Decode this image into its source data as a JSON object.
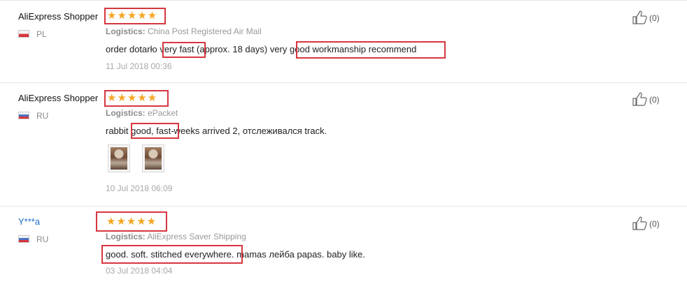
{
  "reviews": [
    {
      "user": "AliExpress Shopper",
      "country": "PL",
      "stars": "★★★★★",
      "logistics_label": "Logistics:",
      "logistics_value": "China Post Registered Air Mail",
      "text": "order dotarło very fast (approx. 18 days) very good workmanship recommend",
      "date": "11 Jul 2018 00:36",
      "helpful_count": "(0)"
    },
    {
      "user": "AliExpress Shopper",
      "country": "RU",
      "stars": "★★★★★",
      "logistics_label": "Logistics:",
      "logistics_value": "ePacket",
      "text": "rabbit good, fast-weeks arrived 2, отслеживался track.",
      "date": "10 Jul 2018 06:09",
      "helpful_count": "(0)",
      "photos": [
        "photo-1",
        "photo-2"
      ]
    },
    {
      "user": "Y***a",
      "country": "RU",
      "stars": "★★★★★",
      "logistics_label": "Logistics:",
      "logistics_value": "AliExpress Saver Shipping",
      "text": "good. soft. stitched everywhere. mamas лейба papas. baby like.",
      "date": "03 Jul 2018 04:04",
      "helpful_count": "(0)"
    }
  ],
  "colors": {
    "star": "#f5a623",
    "highlight_box": "#d6363f",
    "link_user": "#1a6ec2"
  },
  "icons": {
    "helpful": "thumbs-up-icon",
    "flag_pl": "poland-flag-icon",
    "flag_ru": "russia-flag-icon"
  }
}
